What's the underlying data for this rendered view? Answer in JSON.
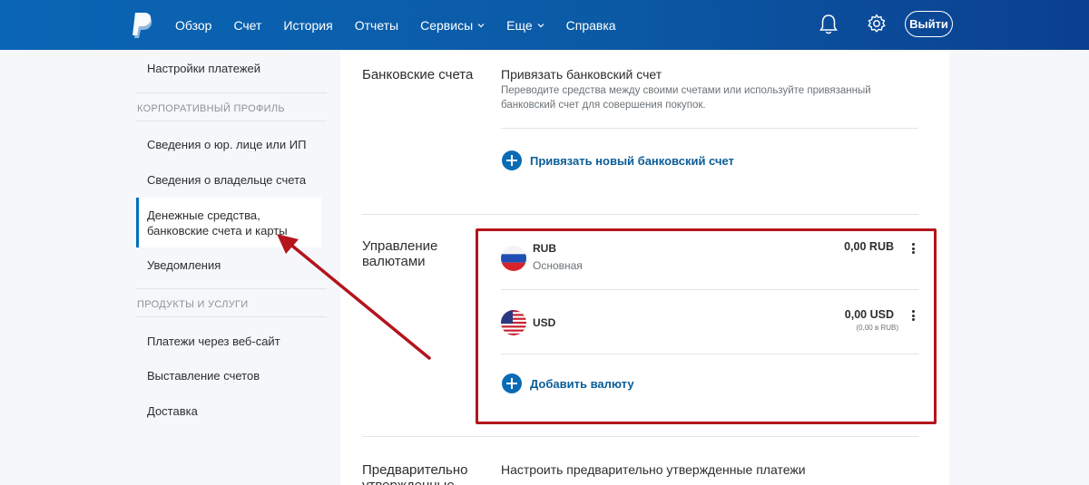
{
  "header": {
    "nav": [
      "Обзор",
      "Счет",
      "История",
      "Отчеты",
      "Сервисы",
      "Еще",
      "Справка"
    ],
    "logout_label": "Выйти",
    "icons": [
      "paypal-logo",
      "bell-icon",
      "gear-icon"
    ]
  },
  "sidebar": {
    "item_top": "Настройки платежей",
    "section1": "КОРПОРАТИВНЫЙ ПРОФИЛЬ",
    "item_legal": "Сведения о юр. лице или ИП",
    "item_owner": "Сведения о владельце счета",
    "item_active": "Денежные средства, банковские счета и карты",
    "item_notifications": "Уведомления",
    "section2": "ПРОДУКТЫ И УСЛУГИ",
    "item_web": "Платежи через веб-сайт",
    "item_invoices": "Выставление счетов",
    "item_shipping": "Доставка"
  },
  "bank": {
    "section_title": "Банковские счета",
    "link_title": "Привязать банковский счет",
    "description": "Переводите средства между своими счетами или используйте привязанный банковский счет для совершения покупок.",
    "add_label": "Привязать новый банковский счет"
  },
  "currency": {
    "section_title": "Управление валютами",
    "items": [
      {
        "code": "RUB",
        "sub": "Основная",
        "amount": "0,00 RUB",
        "amount_sub": ""
      },
      {
        "code": "USD",
        "sub": "",
        "amount": "0,00 USD",
        "amount_sub": "(0,00 в RUB)"
      }
    ],
    "add_label": "Добавить валюту"
  },
  "preapproved": {
    "section_title": "Предварительно утвержденные",
    "link_title": "Настроить предварительно утвержденные платежи"
  },
  "colors": {
    "accent": "#0070ba",
    "highlight": "#b4141c"
  }
}
